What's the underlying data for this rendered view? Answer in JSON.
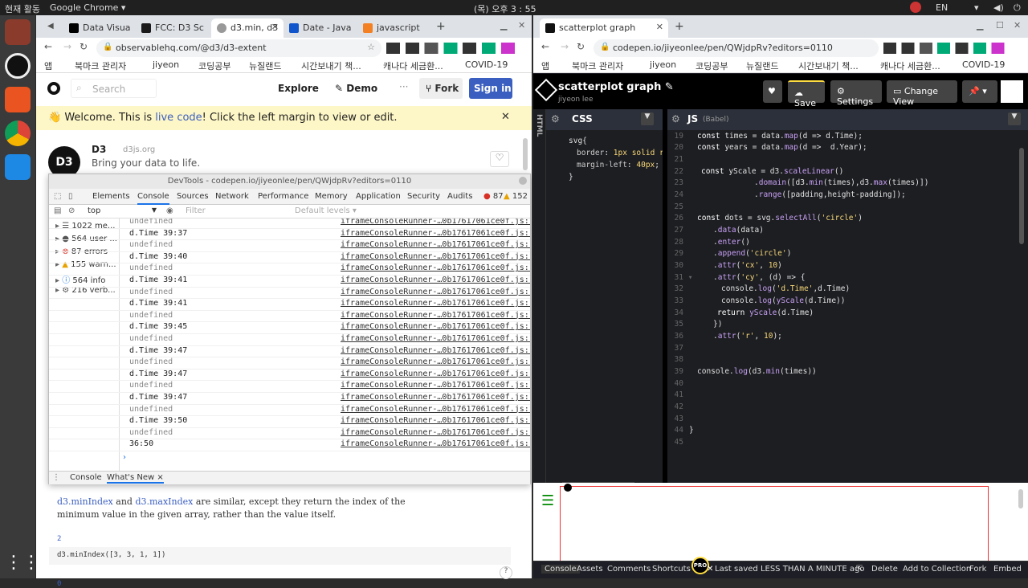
{
  "os": {
    "activities": "현재 활동",
    "app_menu": "Google Chrome ▾",
    "clock": "(목) 오후 3 : 55",
    "lang": "EN"
  },
  "left_browser": {
    "tabs": [
      {
        "label": "Data Visua",
        "fav": "#000"
      },
      {
        "label": "FCC: D3 Sc",
        "fav": "#0a0"
      },
      {
        "label": "d3.min, d3",
        "fav": "#999"
      },
      {
        "label": "Date - Java",
        "fav": "#15c"
      },
      {
        "label": "javascript",
        "fav": "#f48024"
      }
    ],
    "url": "observablehq.com/@d3/d3-extent",
    "bookmarks": [
      "앱",
      "북마크 관리자",
      "jiyeon",
      "코딩공부",
      "뉴질랜드",
      "시간보내기 책...",
      "캐나다 세금환...",
      "COVID-19"
    ],
    "observable": {
      "search_placeholder": "Search",
      "explore": "Explore",
      "demo": "Demo",
      "fork": "Fork",
      "signin": "Sign in",
      "welcome_pre": "👋 Welcome. This is ",
      "welcome_link": "live code",
      "welcome_post": "! Click the left margin to view or edit.",
      "author": "D3",
      "domain": "d3js.org",
      "tagline": "Bring your data to life.",
      "doc_link1": "d3.minIndex",
      "doc_and": "and",
      "doc_link2": "d3.maxIndex",
      "doc_rest": "are similar, except they return the index of the",
      "doc_line2": "minimum value in the given array, rather than the value itself.",
      "cell_out": "2",
      "cell_code": "d3.minIndex([3, 3, 1, 1])",
      "cell_out2": "0",
      "help": "?"
    }
  },
  "devtools": {
    "title": "DevTools - codepen.io/jiyeonlee/pen/QWjdpRv?editors=0110",
    "tabs": [
      "Elements",
      "Console",
      "Sources",
      "Network",
      "Performance",
      "Memory",
      "Application",
      "Security",
      "Audits"
    ],
    "errors": "87",
    "warnings": "152",
    "context": "top",
    "filter_placeholder": "Filter",
    "levels": "Default levels ▾",
    "sidebar": [
      {
        "label": "1022 me...",
        "color": "#555"
      },
      {
        "label": "564 user ...",
        "color": "#555"
      },
      {
        "label": "87 errors",
        "color": "#d93025"
      },
      {
        "label": "155 warn...",
        "color": "#e8a200"
      },
      {
        "label": "564 info",
        "color": "#1a73e8"
      },
      {
        "label": "216 verb...",
        "color": "#555"
      }
    ],
    "log": [
      "undefined",
      "d.Time 39:37",
      "undefined",
      "d.Time 39:40",
      "undefined",
      "d.Time 39:41",
      "undefined",
      "d.Time 39:41",
      "undefined",
      "d.Time 39:45",
      "undefined",
      "d.Time 39:47",
      "undefined",
      "d.Time 39:47",
      "undefined",
      "d.Time 39:47",
      "undefined",
      "d.Time 39:50",
      "undefined",
      "36:50"
    ],
    "source": "iframeConsoleRunner-…0b17617061ce0f.js:1",
    "drawer_console": "Console",
    "drawer_whatsnew": "What's New ×"
  },
  "right_browser": {
    "tab": "scatterplot graph",
    "url": "codepen.io/jiyeonlee/pen/QWjdpRv?editors=0110",
    "bookmarks": [
      "앱",
      "북마크 관리자",
      "jiyeon",
      "코딩공부",
      "뉴질랜드",
      "시간보내기 책...",
      "캐나다 세금환...",
      "COVID-19"
    ],
    "codepen": {
      "title": "scatterplot graph ✎",
      "user": "jiyeon lee",
      "save": "Save",
      "settings": "Settings",
      "change_view": "Change View",
      "html_label": "HTML",
      "css_label": "CSS",
      "js_label": "JS",
      "js_sub": "(Babel)",
      "footer": [
        "Console",
        "Assets",
        "Comments",
        "Shortcuts"
      ],
      "pro": "PRO",
      "saved": "Last saved LESS THAN A MINUTE ago",
      "footer_right": [
        "Delete",
        "Add to Collection",
        "Fork",
        "Embed"
      ]
    }
  }
}
